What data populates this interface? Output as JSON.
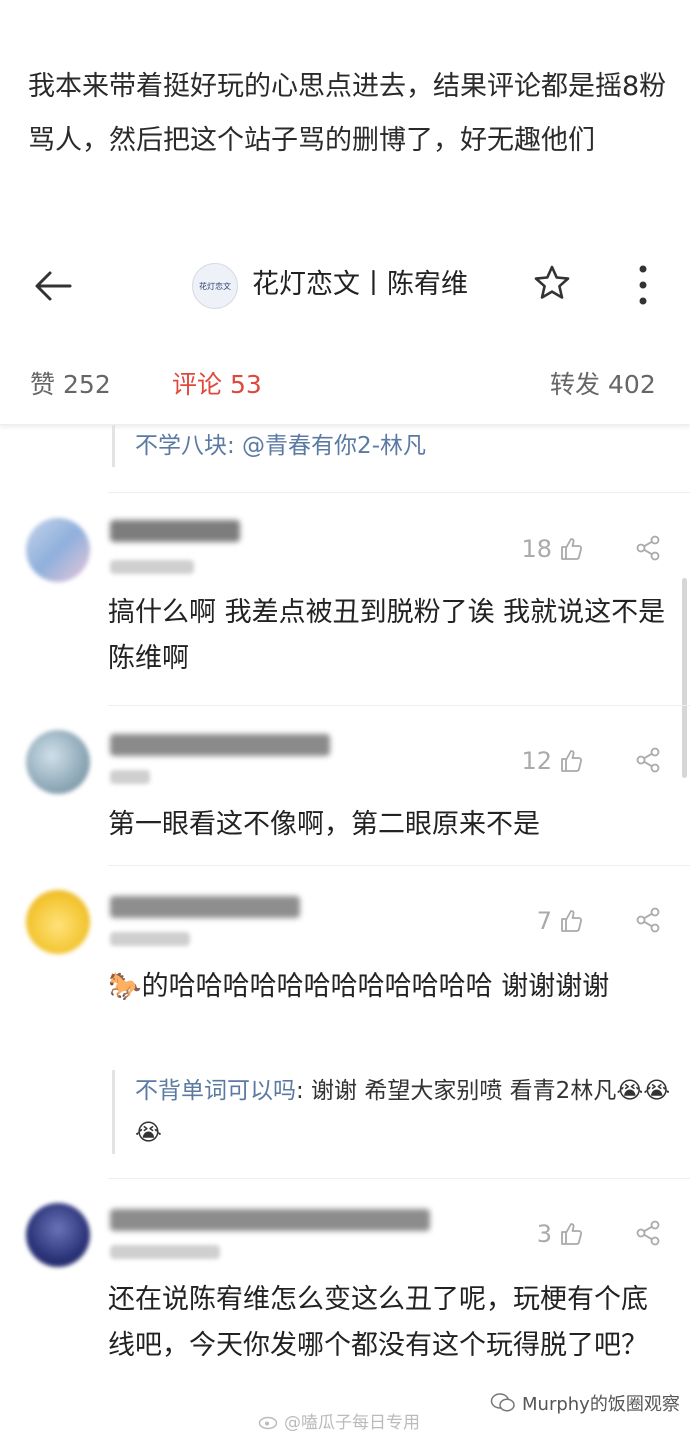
{
  "intro": {
    "text": "我本来带着挺好玩的心思点进去，结果评论都是摇8粉骂人，然后把这个站子骂的删博了，好无趣他们"
  },
  "header": {
    "logo_text": "花灯恋文",
    "title": "花灯恋文丨陈宥维"
  },
  "stats": {
    "likes_label": "赞",
    "likes_count": "252",
    "comments_label": "评论",
    "comments_count": "53",
    "reposts_label": "转发",
    "reposts_count": "402"
  },
  "top_reply": {
    "author": "不学八块",
    "text": ": @青春有你2-林凡"
  },
  "comments": [
    {
      "likes": "18",
      "text": "搞什么啊 我差点被丑到脱粉了诶 我就说这不是陈维啊"
    },
    {
      "likes": "12",
      "text": "第一眼看这不像啊，第二眼原来不是"
    },
    {
      "likes": "7",
      "text": "的哈哈哈哈哈哈哈哈哈哈哈哈 谢谢谢谢",
      "emoji": "🐎",
      "reply": {
        "author": "不背单词可以吗",
        "text": ": 谢谢 希望大家别喷 看青2林凡",
        "emoji": "😭😭😭"
      }
    },
    {
      "likes": "3",
      "text": "还在说陈宥维怎么变这么丑了呢，玩梗有个底线吧，今天你发哪个都没有这个玩得脱了吧？"
    }
  ],
  "watermarks": {
    "left": "@嗑瓜子每日专用",
    "right": "Murphy的饭圈观察"
  },
  "colors": {
    "accent_red": "#e0483c",
    "link_blue": "#5b7aa3",
    "muted_gray": "#aaaaaa"
  }
}
